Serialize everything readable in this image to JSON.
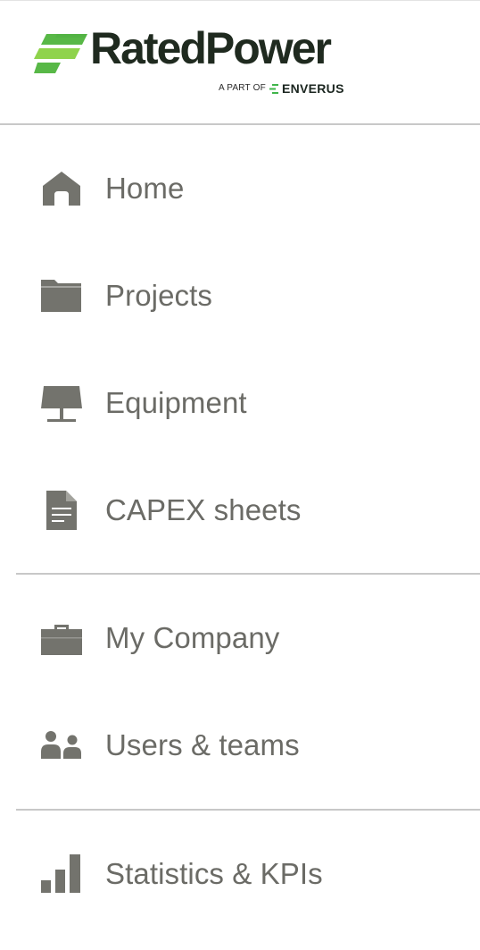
{
  "brand": {
    "name": "RatedPower",
    "tagline": "A PART OF",
    "parent": "ENVERUS",
    "colors": {
      "mark_green_light": "#8fd34c",
      "mark_green": "#58b847",
      "text_dark": "#1f2a1f",
      "enverus_green": "#3fb54a"
    }
  },
  "nav": {
    "label_color": "#6b6b66",
    "icon_color": "#73736d",
    "groups": [
      {
        "items": [
          {
            "label": "Home",
            "icon": "home-icon"
          },
          {
            "label": "Projects",
            "icon": "folder-icon"
          },
          {
            "label": "Equipment",
            "icon": "solar-panel-icon"
          },
          {
            "label": "CAPEX sheets",
            "icon": "document-icon"
          }
        ]
      },
      {
        "items": [
          {
            "label": "My Company",
            "icon": "briefcase-icon"
          },
          {
            "label": "Users & teams",
            "icon": "users-icon"
          }
        ]
      },
      {
        "items": [
          {
            "label": "Statistics & KPIs",
            "icon": "bar-chart-icon"
          }
        ]
      }
    ]
  }
}
